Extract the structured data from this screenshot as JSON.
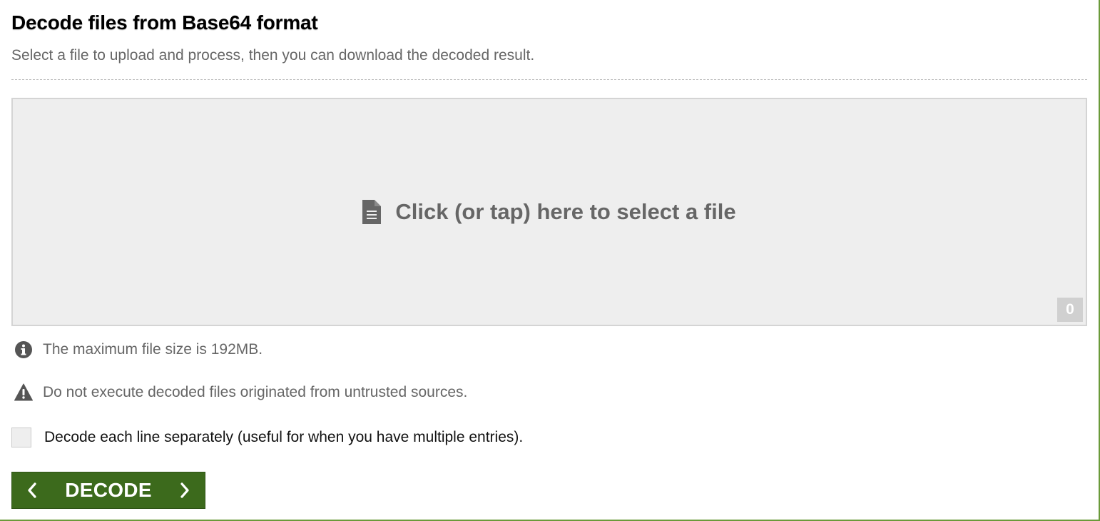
{
  "header": {
    "title": "Decode files from Base64 format",
    "subtitle": "Select a file to upload and process, then you can download the decoded result."
  },
  "dropzone": {
    "label": "Click (or tap) here to select a file",
    "file_count": "0",
    "icon": "file-icon"
  },
  "notes": {
    "info": {
      "icon": "info-icon",
      "text": "The maximum file size is 192MB."
    },
    "warning": {
      "icon": "warning-icon",
      "text": "Do not execute decoded files originated from untrusted sources."
    }
  },
  "options": {
    "decode_lines_label": "Decode each line separately (useful for when you have multiple entries).",
    "decode_lines_checked": false
  },
  "actions": {
    "decode_label": "DECODE"
  },
  "colors": {
    "accent": "#3c6a1c",
    "frame_border": "#6a9a3a",
    "muted_text": "#666666",
    "dropzone_bg": "#eeeeee"
  }
}
